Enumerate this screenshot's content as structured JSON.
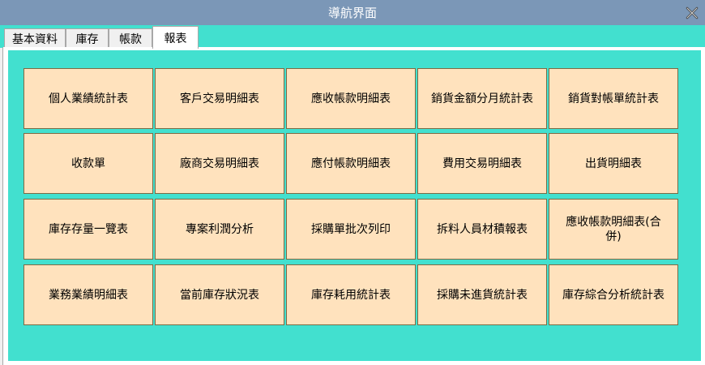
{
  "window": {
    "title": "導航界面",
    "close_icon": "close-x-icon"
  },
  "tabs": [
    {
      "label": "基本資料",
      "selected": false
    },
    {
      "label": "庫存",
      "selected": false
    },
    {
      "label": "帳款",
      "selected": false
    },
    {
      "label": "報表",
      "selected": true
    }
  ],
  "reports": {
    "rows": [
      [
        "個人業績統計表",
        "客戶交易明細表",
        "應收帳款明細表",
        "銷貨金額分月統計表",
        "銷貨對帳單統計表"
      ],
      [
        "收款單",
        "廠商交易明細表",
        "應付帳款明細表",
        "費用交易明細表",
        "出貨明細表"
      ],
      [
        "庫存存量一覽表",
        "專案利潤分析",
        "採購單批次列印",
        "拆料人員材積報表",
        "應收帳款明細表(合併)"
      ],
      [
        "業務業績明細表",
        "當前庫存狀況表",
        "庫存耗用統計表",
        "採購未進貨統計表",
        "庫存綜合分析統計表"
      ]
    ]
  },
  "colors": {
    "titlebar": "#7b97b7",
    "tabstrip": "#42e0cf",
    "tile_fill": "#ffe2bd",
    "tile_border": "#7d6a44"
  }
}
